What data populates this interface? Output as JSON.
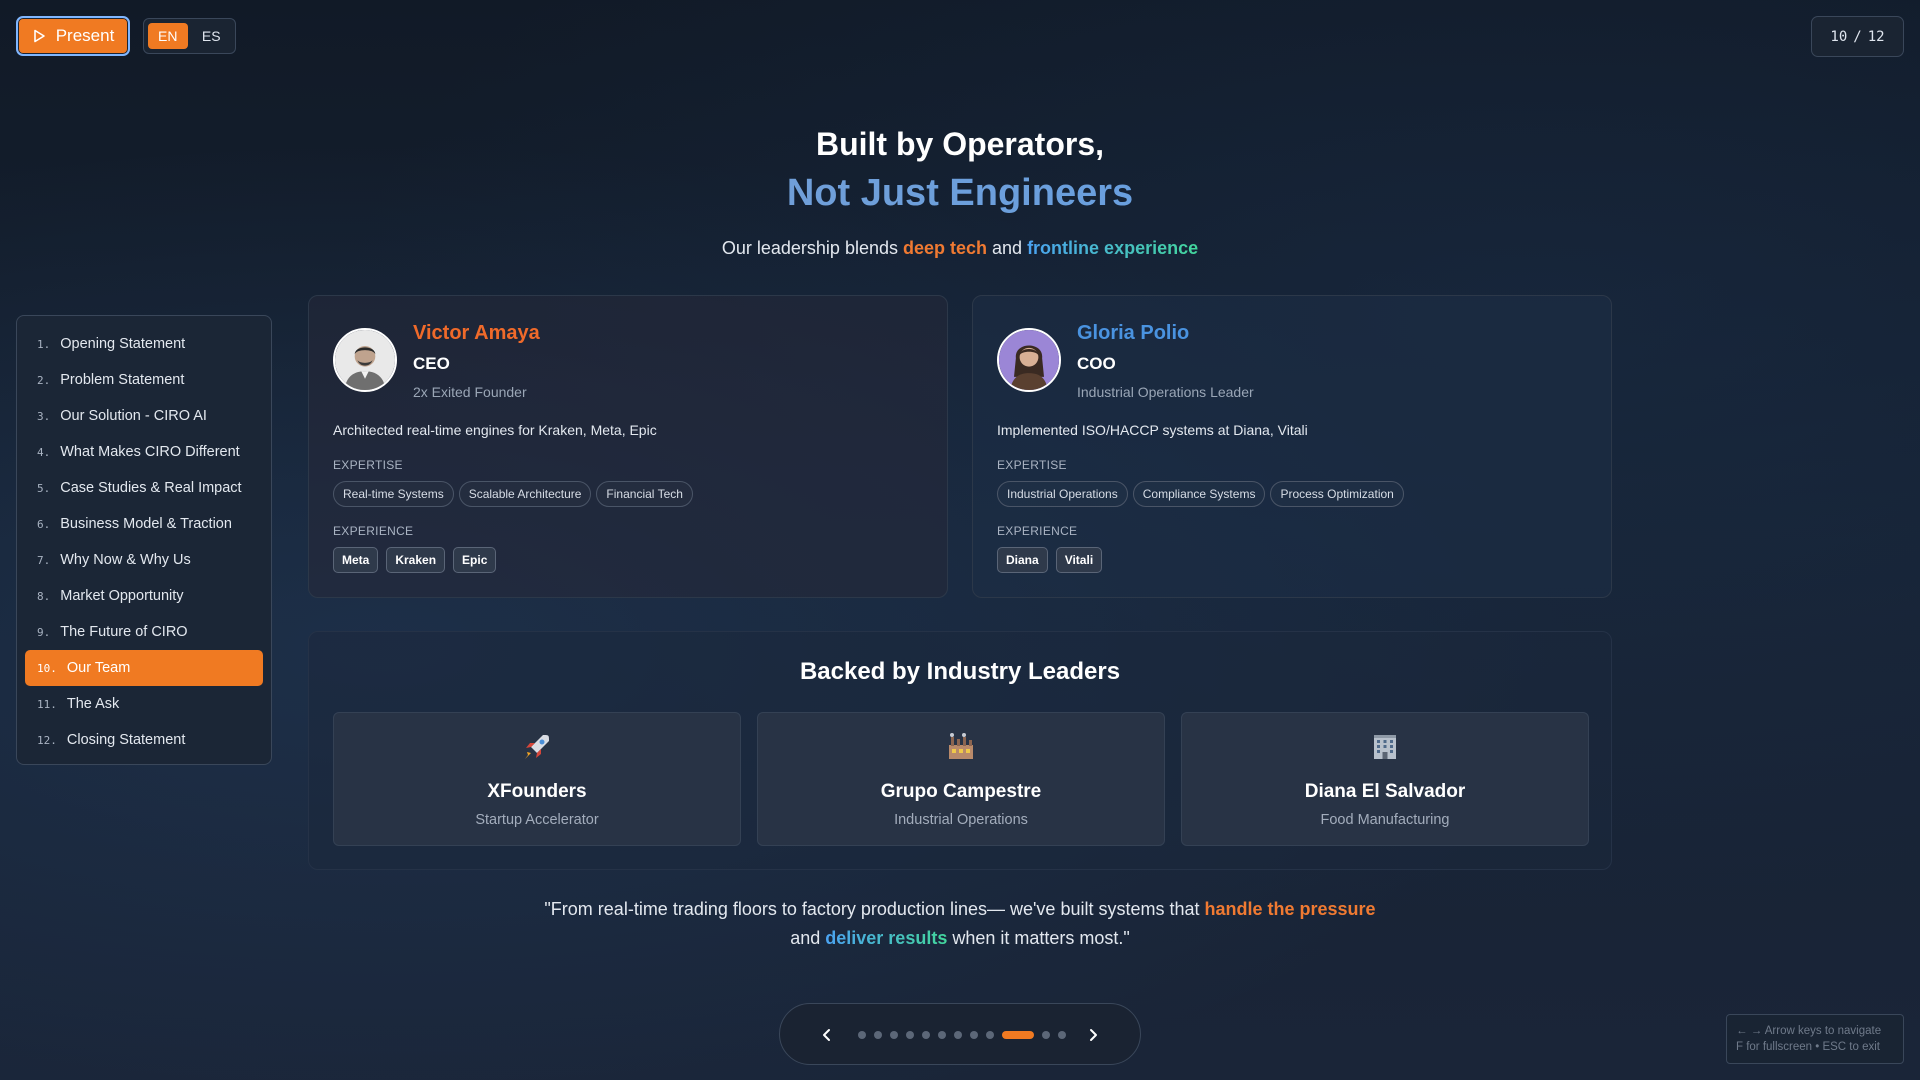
{
  "controls": {
    "present_label": "Present",
    "languages": [
      "EN",
      "ES"
    ],
    "active_language": "EN",
    "slide_current": "10",
    "slide_separator": "/",
    "slide_total": "12"
  },
  "header": {
    "title_line1": "Built by Operators,",
    "title_line2": "Not Just Engineers",
    "subtitle_prefix": "Our leadership blends ",
    "subtitle_highlight1": "deep tech",
    "subtitle_middle": " and ",
    "subtitle_highlight2": "frontline experience"
  },
  "sidebar": {
    "items": [
      {
        "num": "1.",
        "label": "Opening Statement"
      },
      {
        "num": "2.",
        "label": "Problem Statement"
      },
      {
        "num": "3.",
        "label": "Our Solution - CIRO AI"
      },
      {
        "num": "4.",
        "label": "What Makes CIRO Different"
      },
      {
        "num": "5.",
        "label": "Case Studies & Real Impact"
      },
      {
        "num": "6.",
        "label": "Business Model & Traction"
      },
      {
        "num": "7.",
        "label": "Why Now & Why Us"
      },
      {
        "num": "8.",
        "label": "Market Opportunity"
      },
      {
        "num": "9.",
        "label": "The Future of CIRO"
      },
      {
        "num": "10.",
        "label": "Our Team"
      },
      {
        "num": "11.",
        "label": "The Ask"
      },
      {
        "num": "12.",
        "label": "Closing Statement"
      }
    ],
    "active_index": 9
  },
  "team": [
    {
      "name": "Victor Amaya",
      "role": "CEO",
      "tagline": "2x Exited Founder",
      "description": "Architected real-time engines for Kraken, Meta, Epic",
      "expertise_label": "EXPERTISE",
      "expertise": [
        "Real-time Systems",
        "Scalable Architecture",
        "Financial Tech"
      ],
      "experience_label": "EXPERIENCE",
      "experience": [
        "Meta",
        "Kraken",
        "Epic"
      ]
    },
    {
      "name": "Gloria Polio",
      "role": "COO",
      "tagline": "Industrial Operations Leader",
      "description": "Implemented ISO/HACCP systems at Diana, Vitali",
      "expertise_label": "EXPERTISE",
      "expertise": [
        "Industrial Operations",
        "Compliance Systems",
        "Process Optimization"
      ],
      "experience_label": "EXPERIENCE",
      "experience": [
        "Diana",
        "Vitali"
      ]
    }
  ],
  "backers": {
    "title": "Backed by Industry Leaders",
    "items": [
      {
        "icon": "rocket-icon",
        "name": "XFounders",
        "type": "Startup Accelerator"
      },
      {
        "icon": "factory-icon",
        "name": "Grupo Campestre",
        "type": "Industrial Operations"
      },
      {
        "icon": "office-building-icon",
        "name": "Diana El Salvador",
        "type": "Food Manufacturing"
      }
    ]
  },
  "quote": {
    "part1": "\"From real-time trading floors to factory production lines— we've built systems that ",
    "highlight1": "handle the pressure",
    "part2": "and ",
    "highlight2": "deliver results",
    "part3": " when it matters most.\""
  },
  "pager": {
    "total": 12,
    "active": 10
  },
  "hint": {
    "line1": "← → Arrow keys to navigate",
    "line2": "F for fullscreen • ESC to exit"
  },
  "colors": {
    "accent": "#f07a22",
    "blue": "#4a93e0",
    "green": "#43d69c",
    "background": "#162233"
  }
}
